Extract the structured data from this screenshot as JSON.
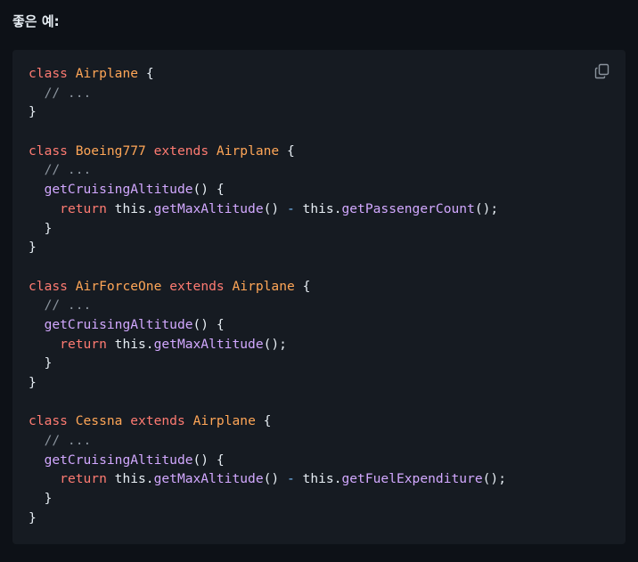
{
  "heading": "좋은 예:",
  "copy_icon": "copy-icon",
  "colors": {
    "background": "#0d1117",
    "code_background": "#161b22",
    "keyword": "#ff7b72",
    "class_name": "#ffa657",
    "function": "#d2a8ff",
    "comment": "#8b949e",
    "operator": "#79c0ff",
    "text": "#e6edf3"
  },
  "code_lines": [
    [
      {
        "t": "class",
        "c": "kw"
      },
      {
        "t": " ",
        "c": "pl"
      },
      {
        "t": "Airplane",
        "c": "cls"
      },
      {
        "t": " {",
        "c": "pl"
      }
    ],
    [
      {
        "t": "  // ...",
        "c": "cm"
      }
    ],
    [
      {
        "t": "}",
        "c": "pl"
      }
    ],
    [],
    [
      {
        "t": "class",
        "c": "kw"
      },
      {
        "t": " ",
        "c": "pl"
      },
      {
        "t": "Boeing777",
        "c": "cls"
      },
      {
        "t": " ",
        "c": "pl"
      },
      {
        "t": "extends",
        "c": "kw"
      },
      {
        "t": " ",
        "c": "pl"
      },
      {
        "t": "Airplane",
        "c": "cls"
      },
      {
        "t": " {",
        "c": "pl"
      }
    ],
    [
      {
        "t": "  // ...",
        "c": "cm"
      }
    ],
    [
      {
        "t": "  ",
        "c": "pl"
      },
      {
        "t": "getCruisingAltitude",
        "c": "fn"
      },
      {
        "t": "() {",
        "c": "pl"
      }
    ],
    [
      {
        "t": "    ",
        "c": "pl"
      },
      {
        "t": "return",
        "c": "kw"
      },
      {
        "t": " this.",
        "c": "pl"
      },
      {
        "t": "getMaxAltitude",
        "c": "fn"
      },
      {
        "t": "() ",
        "c": "pl"
      },
      {
        "t": "-",
        "c": "op"
      },
      {
        "t": " this.",
        "c": "pl"
      },
      {
        "t": "getPassengerCount",
        "c": "fn"
      },
      {
        "t": "();",
        "c": "pl"
      }
    ],
    [
      {
        "t": "  }",
        "c": "pl"
      }
    ],
    [
      {
        "t": "}",
        "c": "pl"
      }
    ],
    [],
    [
      {
        "t": "class",
        "c": "kw"
      },
      {
        "t": " ",
        "c": "pl"
      },
      {
        "t": "AirForceOne",
        "c": "cls"
      },
      {
        "t": " ",
        "c": "pl"
      },
      {
        "t": "extends",
        "c": "kw"
      },
      {
        "t": " ",
        "c": "pl"
      },
      {
        "t": "Airplane",
        "c": "cls"
      },
      {
        "t": " {",
        "c": "pl"
      }
    ],
    [
      {
        "t": "  // ...",
        "c": "cm"
      }
    ],
    [
      {
        "t": "  ",
        "c": "pl"
      },
      {
        "t": "getCruisingAltitude",
        "c": "fn"
      },
      {
        "t": "() {",
        "c": "pl"
      }
    ],
    [
      {
        "t": "    ",
        "c": "pl"
      },
      {
        "t": "return",
        "c": "kw"
      },
      {
        "t": " this.",
        "c": "pl"
      },
      {
        "t": "getMaxAltitude",
        "c": "fn"
      },
      {
        "t": "();",
        "c": "pl"
      }
    ],
    [
      {
        "t": "  }",
        "c": "pl"
      }
    ],
    [
      {
        "t": "}",
        "c": "pl"
      }
    ],
    [],
    [
      {
        "t": "class",
        "c": "kw"
      },
      {
        "t": " ",
        "c": "pl"
      },
      {
        "t": "Cessna",
        "c": "cls"
      },
      {
        "t": " ",
        "c": "pl"
      },
      {
        "t": "extends",
        "c": "kw"
      },
      {
        "t": " ",
        "c": "pl"
      },
      {
        "t": "Airplane",
        "c": "cls"
      },
      {
        "t": " {",
        "c": "pl"
      }
    ],
    [
      {
        "t": "  // ...",
        "c": "cm"
      }
    ],
    [
      {
        "t": "  ",
        "c": "pl"
      },
      {
        "t": "getCruisingAltitude",
        "c": "fn"
      },
      {
        "t": "() {",
        "c": "pl"
      }
    ],
    [
      {
        "t": "    ",
        "c": "pl"
      },
      {
        "t": "return",
        "c": "kw"
      },
      {
        "t": " this.",
        "c": "pl"
      },
      {
        "t": "getMaxAltitude",
        "c": "fn"
      },
      {
        "t": "() ",
        "c": "pl"
      },
      {
        "t": "-",
        "c": "op"
      },
      {
        "t": " this.",
        "c": "pl"
      },
      {
        "t": "getFuelExpenditure",
        "c": "fn"
      },
      {
        "t": "();",
        "c": "pl"
      }
    ],
    [
      {
        "t": "  }",
        "c": "pl"
      }
    ],
    [
      {
        "t": "}",
        "c": "pl"
      }
    ]
  ]
}
